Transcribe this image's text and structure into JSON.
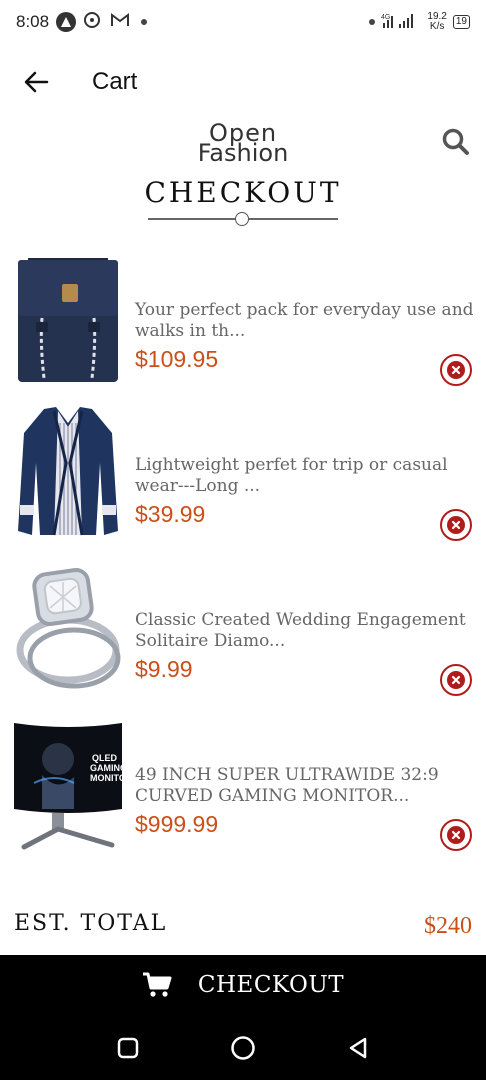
{
  "status_bar": {
    "time": "8:08",
    "network_type": "4G",
    "net_speed_value": "19.2",
    "net_speed_unit": "K/s",
    "battery": "19"
  },
  "app_bar": {
    "title": "Cart"
  },
  "header": {
    "logo_line1": "Open",
    "logo_line2": "Fashion",
    "heading": "CHECKOUT"
  },
  "cart": {
    "items": [
      {
        "title_line1": "Your perfect pack for everyday use and",
        "title_line2": "walks in th...",
        "price": "$109.95",
        "image": "backpack"
      },
      {
        "title_line1": "Lightweight perfet for trip or casual",
        "title_line2": "wear---Long ...",
        "price": "$39.99",
        "image": "jacket"
      },
      {
        "title_line1": "Classic Created Wedding Engagement",
        "title_line2": "Solitaire Diamo...",
        "price": "$9.99",
        "image": "ring"
      },
      {
        "title_line1": "49 INCH SUPER ULTRAWIDE 32:9",
        "title_line2": "CURVED GAMING MONITOR...",
        "price": "$999.99",
        "image": "monitor"
      }
    ]
  },
  "monitor_screen_text": [
    "QLED",
    "GAMING",
    "MONITOR"
  ],
  "summary": {
    "label": "EST. TOTAL",
    "value": "$240"
  },
  "checkout_button": {
    "label": "CHECKOUT"
  },
  "colors": {
    "price": "#c8501a",
    "remove": "#b01c1c",
    "button_bg": "#000000"
  },
  "icons": {
    "back": "arrow-left-icon",
    "search": "search-icon",
    "remove": "close-circle-icon",
    "cart": "cart-icon"
  }
}
